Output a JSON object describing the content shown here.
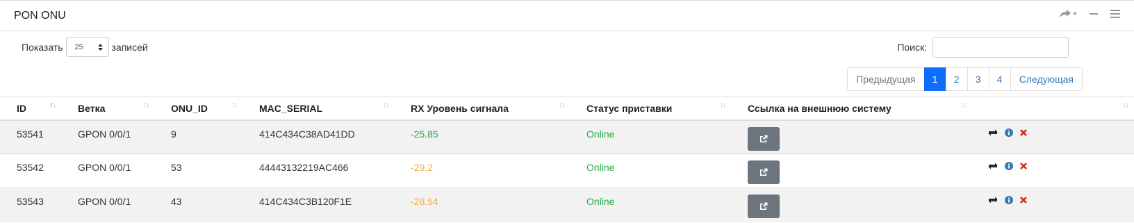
{
  "panel": {
    "title": "PON ONU"
  },
  "length_menu": {
    "prefix": "Показать",
    "value": "25",
    "suffix": "записей"
  },
  "search": {
    "label": "Поиск:",
    "placeholder": ""
  },
  "pagination": {
    "prev": "Предыдущая",
    "pages": [
      "1",
      "2",
      "3",
      "4"
    ],
    "active": "1",
    "next": "Следующая"
  },
  "table": {
    "columns": [
      "ID",
      "Ветка",
      "ONU_ID",
      "MAC_SERIAL",
      "RX Уровень сигнала",
      "Статус приставки",
      "Ссылка на внешнюю систему",
      ""
    ],
    "rows": [
      {
        "id": "53541",
        "branch": "GPON 0/0/1",
        "onu_id": "9",
        "mac": "414C434C38AD41DD",
        "rx": "-25.85",
        "rx_color": "#28a745",
        "status": "Online"
      },
      {
        "id": "53542",
        "branch": "GPON 0/0/1",
        "onu_id": "53",
        "mac": "44443132219AC466",
        "rx": "-29.2",
        "rx_color": "#f0ad4e",
        "status": "Online"
      },
      {
        "id": "53543",
        "branch": "GPON 0/0/1",
        "onu_id": "43",
        "mac": "414C434C3B120F1E",
        "rx": "-28.54",
        "rx_color": "#f0ad4e",
        "status": "Online"
      }
    ]
  },
  "icons": {
    "header": [
      "share-icon",
      "minimize-icon",
      "menu-icon"
    ],
    "row_actions": [
      "refresh-icon",
      "info-icon",
      "delete-icon"
    ],
    "external": "external-link-icon"
  }
}
